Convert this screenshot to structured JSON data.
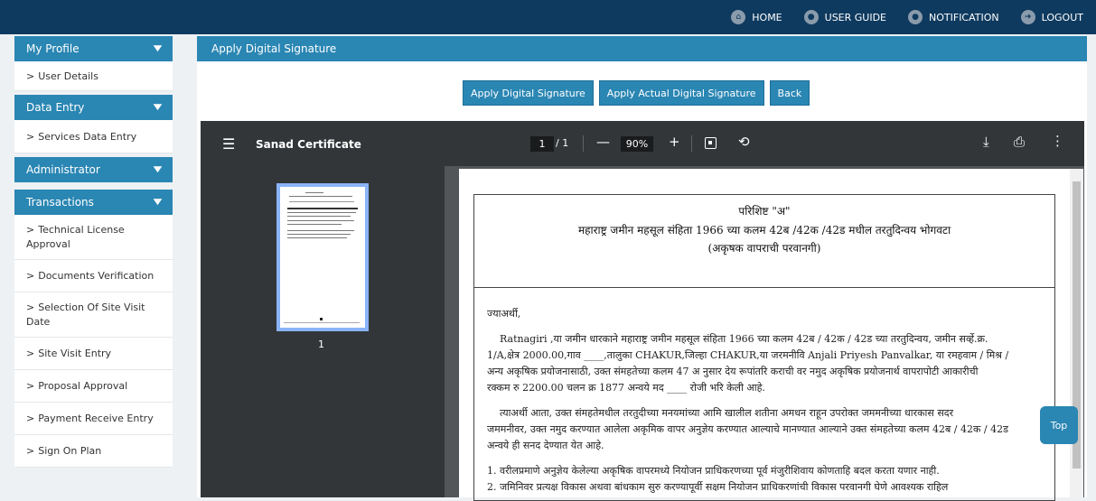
{
  "topnav": [
    {
      "label": "HOME",
      "icon": "home-icon",
      "glyph": "⌂"
    },
    {
      "label": "USER GUIDE",
      "icon": "user-icon",
      "glyph": "●"
    },
    {
      "label": "NOTIFICATION",
      "icon": "bell-icon",
      "glyph": "●"
    },
    {
      "label": "LOGOUT",
      "icon": "logout-icon",
      "glyph": "➜"
    }
  ],
  "sidebar": {
    "sections": [
      {
        "title": "My Profile",
        "items": [
          "User Details"
        ]
      },
      {
        "title": "Data Entry",
        "items": [
          "Services Data Entry"
        ]
      },
      {
        "title": "Administrator",
        "items": []
      },
      {
        "title": "Transactions",
        "items": [
          "Technical License Approval",
          "Documents Verification",
          "Selection Of Site Visit Date",
          "Site Visit Entry",
          "Proposal Approval",
          "Payment Receive Entry",
          "Sign On Plan"
        ]
      }
    ]
  },
  "main": {
    "title": "Apply Digital Signature",
    "buttons": [
      "Apply Digital Signature",
      "Apply Actual Digital Signature",
      "Back"
    ]
  },
  "viewer": {
    "doc_title": "Sanad Certificate",
    "page_current": "1",
    "page_total": "/ 1",
    "zoom": "90%",
    "thumb_label": "1",
    "doc": {
      "heading1": "परिशिष्ट \"अ\"",
      "heading2": "महाराष्ट्र जमीन महसूल संहिता 1966 च्या कलम 42ब /42क /42ड मधील तरतुदिन्वय भोगवटा",
      "heading3": "(अकृषक वापराची परवानगी)",
      "body": [
        "ज्याअर्थी,",
        "Ratnagiri ,या जमीन धारकाने महाराष्ट्र जमीन महसूल संहिता 1966 च्या कलम 42ब / 42क / 42ड च्या तरतुदिन्वय, जमीन सर्व्हे.क्र.",
        "1/A,क्षेत्र 2000.00,गाव ____,तालुका CHAKUR,जिल्हा CHAKUR,या जरमनीवि Anjali Priyesh Panvalkar, या रमहवाम / मिश्र /",
        "अन्य अकृषिक प्रयोजनासाठी, उक्त संमहतेच्या कलम 47 अ नुसार देय रूपांतरि कराची वर नमुद अकृषिक प्रयोजनार्थ वापरापोटी आकारीची",
        "रक्कम रु 2200.00 चलन क्र 1877 अन्वये मद ____ रोजी भरि केली आहे.",
        "त्याअर्थी आता, उक्त संमहतेमधील तरतुदीच्या मनयमांच्या आमि खालील शतीना अमधन राहून उपरोक्त जममनीच्या धारकास सदर",
        "जममनीवर, उक्त नमुद करण्यात आलेला अकृमिक वापर अनुज्ञेय करण्यात आल्याचे मानण्यात आल्याने उक्त संमहतेच्या कलम 42ब / 42क / 42ड",
        "अन्वये ही सनद देण्यात येत आहे.",
        "1.  वरीलप्रमाणे अनुज्ञेय केलेल्या अकृषिक वापरमध्ये नियोजन प्राधिकरणच्या पूर्व मंजुरीशिवाय कोणताहि बदल करता यणार नाही.",
        "2.  जमिनिवर प्रत्यक्ष विकास अथवा बांधकाम सुरु करण्यापूर्वी सक्षम नियोजन प्राधिकरणांची विकास परवानगी घेणे आवश्यक राहिल"
      ]
    }
  },
  "top_button": "Top"
}
